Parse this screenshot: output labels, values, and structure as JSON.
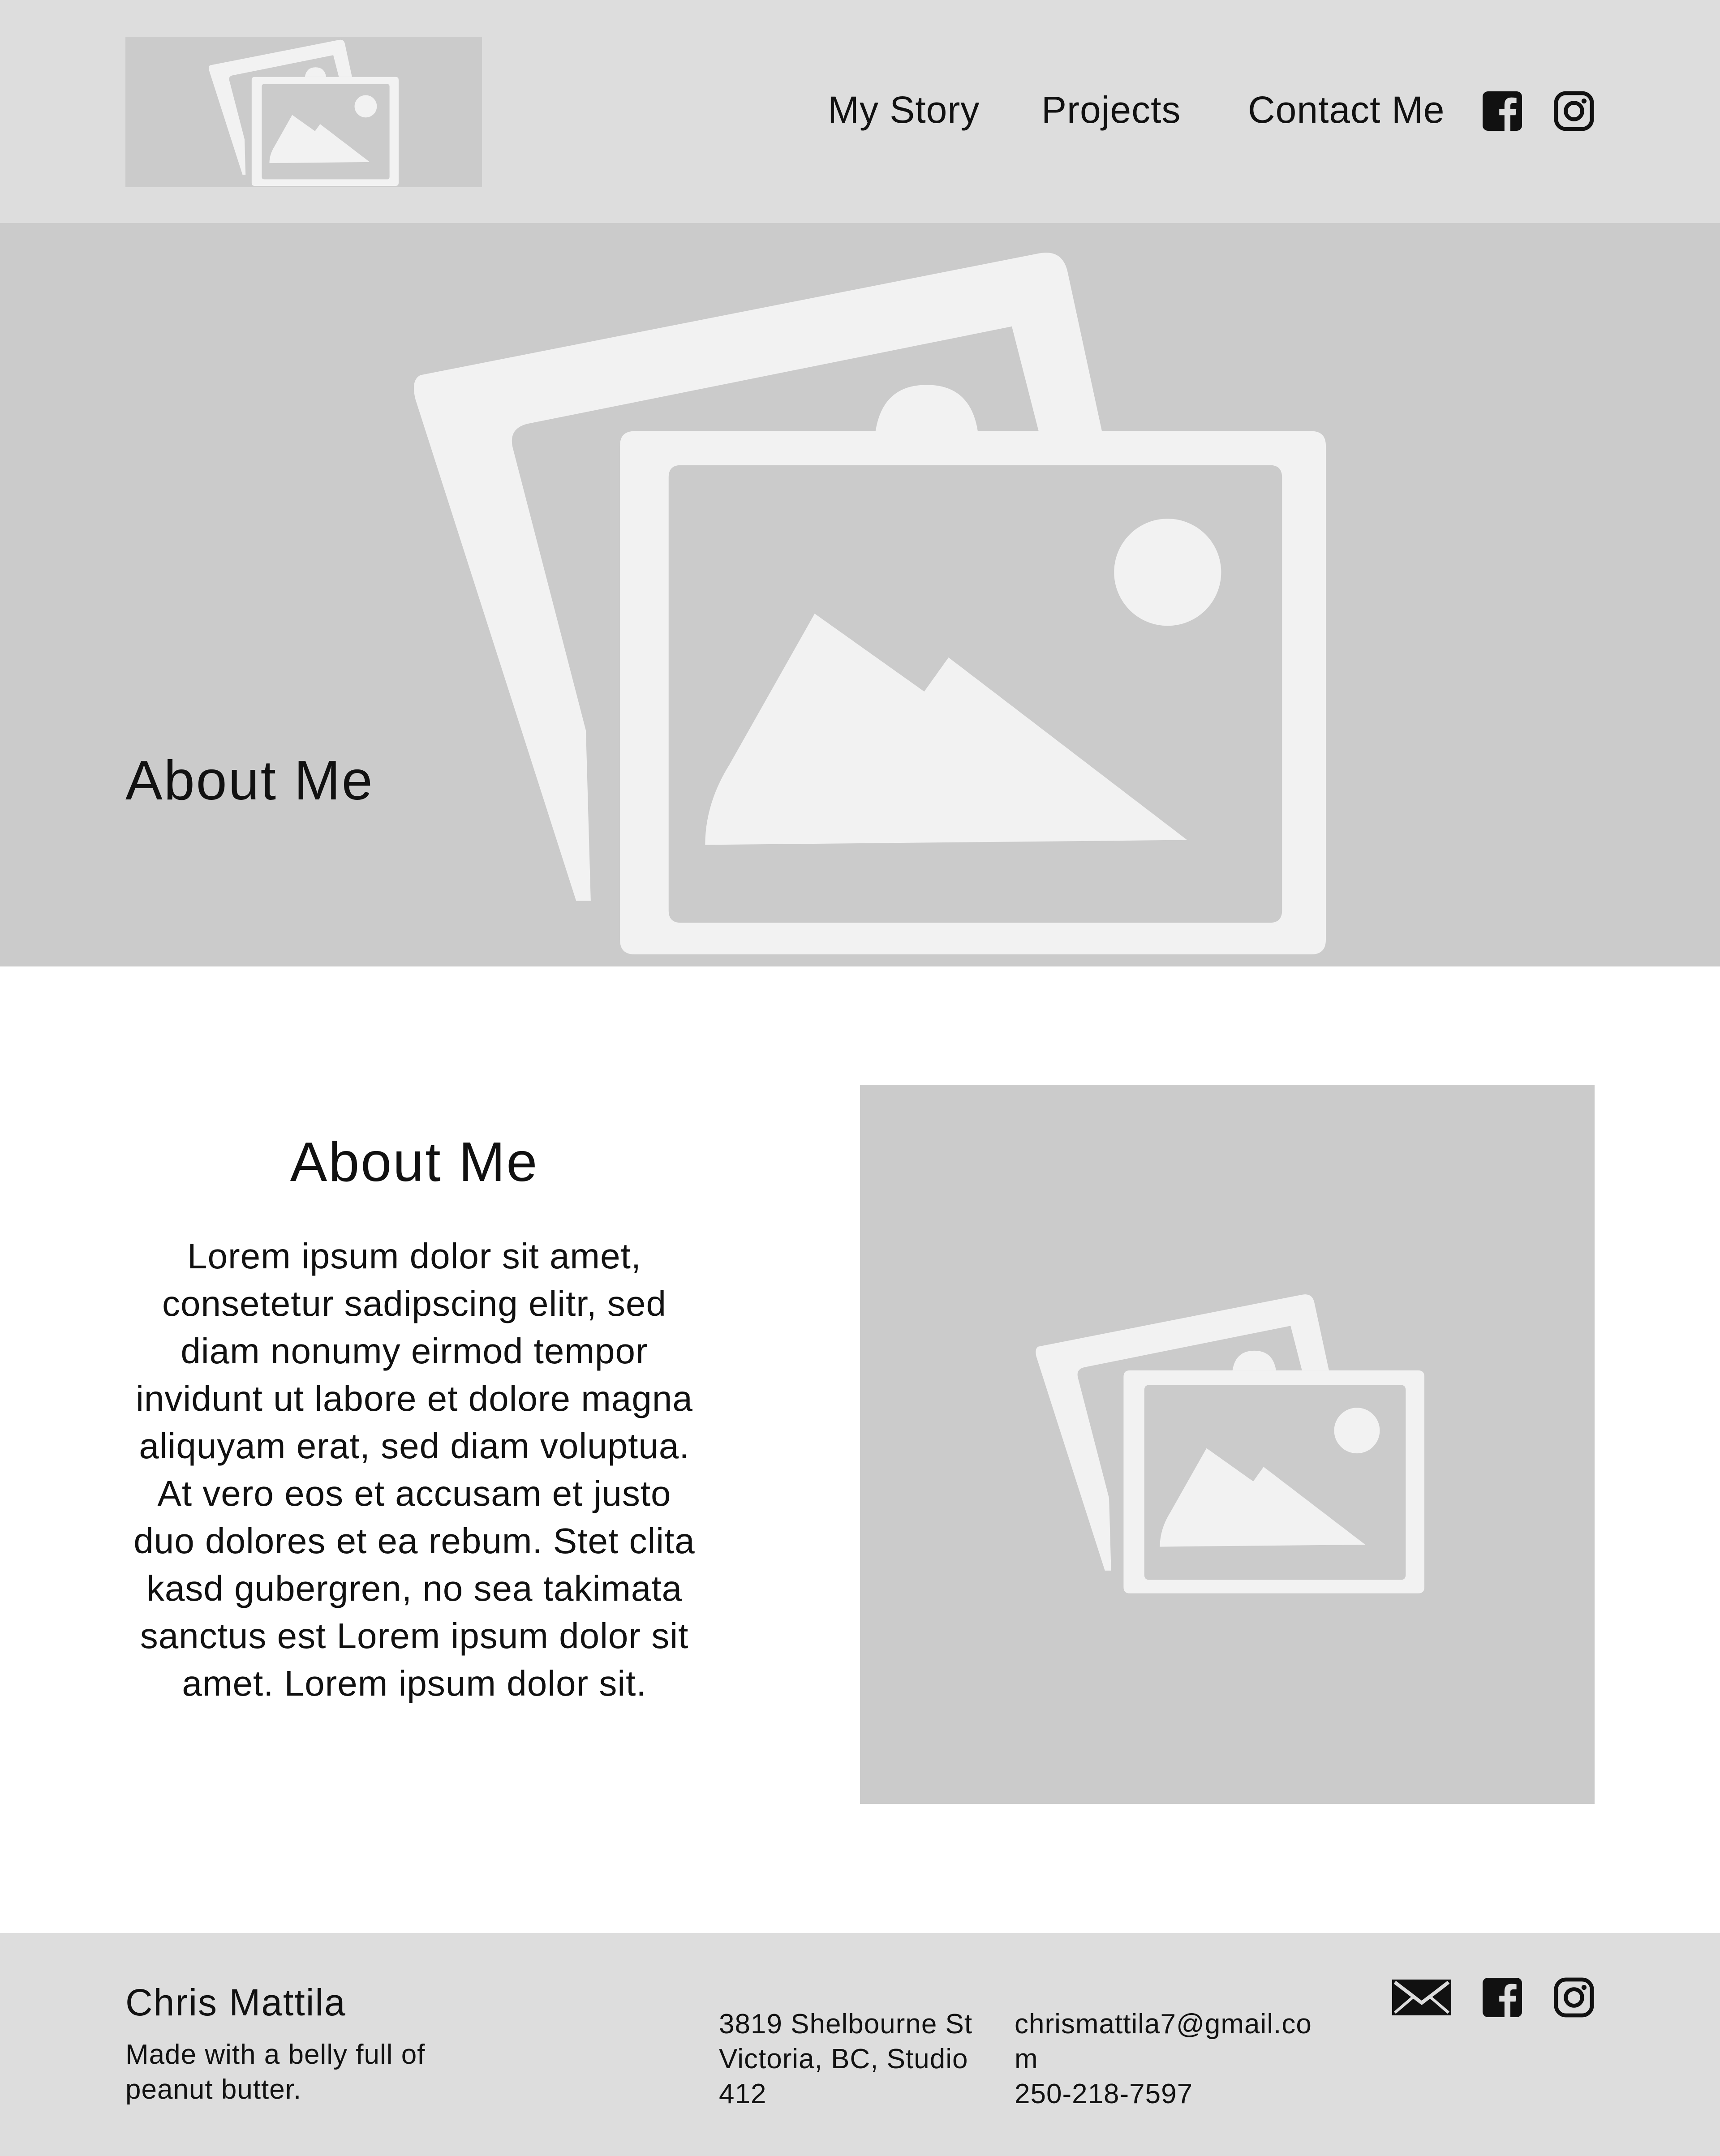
{
  "header": {
    "logo_icon": "image-placeholder-icon",
    "nav": [
      {
        "label": "My Story"
      },
      {
        "label": "Projects"
      },
      {
        "label": "Contact Me"
      }
    ],
    "social_icons": [
      "facebook-icon",
      "instagram-icon"
    ]
  },
  "hero": {
    "title": "About Me",
    "image_icon": "image-placeholder-icon"
  },
  "about": {
    "title": "About Me",
    "body": "Lorem ipsum dolor sit amet, consetetur sadipscing elitr, sed diam nonumy eirmod tempor invidunt ut labore et dolore magna aliquyam erat, sed diam voluptua. At vero eos et accusam et justo duo dolores et ea rebum. Stet clita kasd gubergren, no sea takimata sanctus est Lorem ipsum dolor sit amet. Lorem ipsum dolor sit.",
    "image_icon": "image-placeholder-icon"
  },
  "footer": {
    "name": "Chris Mattila",
    "tagline": "Made with a belly full of peanut butter.",
    "address": "3819 Shelbourne St Victoria, BC, Studio 412",
    "email": "chrismattila7@gmail.com",
    "phone": "250-218-7597",
    "social_icons": [
      "mail-icon",
      "facebook-icon",
      "instagram-icon"
    ]
  },
  "colors": {
    "header_bg": "#dddddd",
    "placeholder_bg": "#cbcbcb",
    "placeholder_icon": "#f2f2f2",
    "page_bg": "#ffffff",
    "text": "#111111"
  }
}
